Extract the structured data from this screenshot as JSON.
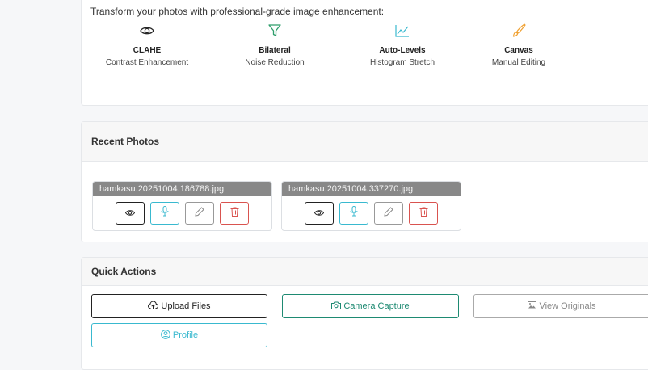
{
  "intro": {
    "text": "Transform your photos with professional-grade image enhancement:",
    "features": [
      {
        "name": "CLAHE",
        "desc": "Contrast Enhancement",
        "icon": "eye-icon",
        "color": "#222222"
      },
      {
        "name": "Bilateral",
        "desc": "Noise Reduction",
        "icon": "filter-icon",
        "color": "#2e9e6b"
      },
      {
        "name": "Auto-Levels",
        "desc": "Histogram Stretch",
        "icon": "chart-line-icon",
        "color": "#39b9cf"
      },
      {
        "name": "Canvas",
        "desc": "Manual Editing",
        "icon": "paintbrush-icon",
        "color": "#f0a030"
      }
    ]
  },
  "recent": {
    "title": "Recent Photos",
    "photos": [
      {
        "alt": "hamkasu.20251004.186788.jpg"
      },
      {
        "alt": "hamkasu.20251004.337270.jpg"
      }
    ]
  },
  "quick": {
    "title": "Quick Actions",
    "upload": "Upload Files",
    "camera": "Camera Capture",
    "originals": "View Originals",
    "profile": "Profile"
  },
  "colors": {
    "danger": "#d9534f",
    "info": "#39b9cf",
    "success": "#1e8a72"
  }
}
